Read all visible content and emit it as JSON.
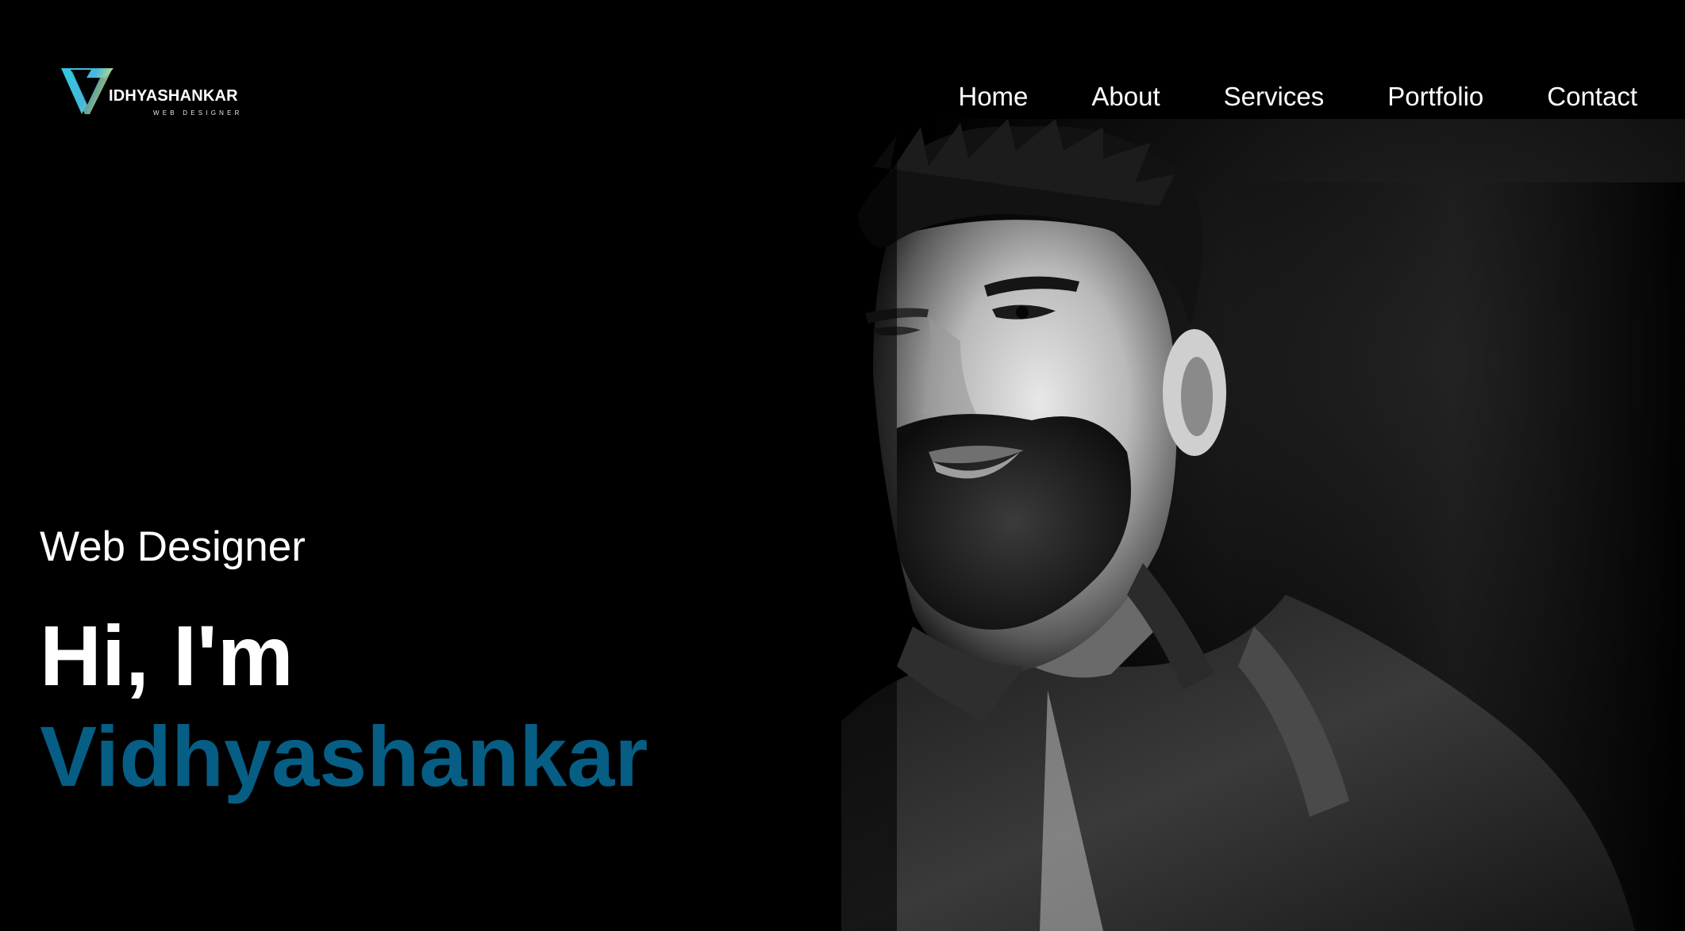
{
  "brand": {
    "name": "IDHYASHANKAR",
    "tagline": "WEB DESIGNER",
    "logo_icon": "v-triangle-logo-icon",
    "colors": {
      "logo_gradient_start": "#31c8e0",
      "logo_gradient_end": "#e8e36a"
    }
  },
  "nav": {
    "items": [
      {
        "label": "Home"
      },
      {
        "label": "About"
      },
      {
        "label": "Services"
      },
      {
        "label": "Portfolio"
      },
      {
        "label": "Contact"
      }
    ]
  },
  "hero": {
    "role": "Web Designer",
    "greeting": "Hi, I'm",
    "name": "Vidhyashankar",
    "colors": {
      "name_accent": "#065e85",
      "background": "#000000"
    }
  }
}
